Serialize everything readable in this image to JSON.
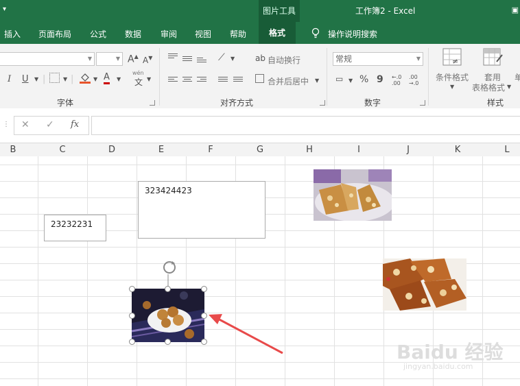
{
  "titlebar": {
    "qat": "▾",
    "context_tab_group": "图片工具",
    "document_title": "工作簿2 - Excel"
  },
  "tabs": [
    "插入",
    "页面布局",
    "公式",
    "数据",
    "审阅",
    "视图",
    "帮助",
    "格式"
  ],
  "active_tab": "格式",
  "tell_me": "操作说明搜索",
  "ribbon": {
    "font_group": "字体",
    "alignment_group": "对齐方式",
    "number_group": "数字",
    "styles_group": "样式",
    "wrap_text": "自动换行",
    "merge_center": "合并后居中",
    "number_format": "常规",
    "conditional_format": "条件格式",
    "table_format_1": "套用",
    "table_format_2": "表格格式",
    "percent": "%",
    "comma": "9",
    "wen": "wén",
    "wen_char": "文",
    "increase_decimal": "←.0 .00",
    "decrease_decimal": ".00 →.0",
    "font_grow": "A",
    "font_shrink": "A",
    "italic": "I",
    "underline": "U",
    "font_color": "A"
  },
  "formula_bar": {
    "cancel": "✕",
    "enter": "✓",
    "fx": "fx",
    "value": ""
  },
  "columns": [
    "B",
    "C",
    "D",
    "E",
    "F",
    "G",
    "H",
    "I",
    "J",
    "K",
    "L"
  ],
  "sheet": {
    "textbox1": "23232231",
    "textbox2": "323424423"
  },
  "watermark": {
    "brand": "Baidu 经验",
    "url": "jingyan.baidu.com"
  },
  "colors": {
    "excel_green": "#217346",
    "context_green": "#185c37",
    "arrow_red": "#e84a4a"
  }
}
